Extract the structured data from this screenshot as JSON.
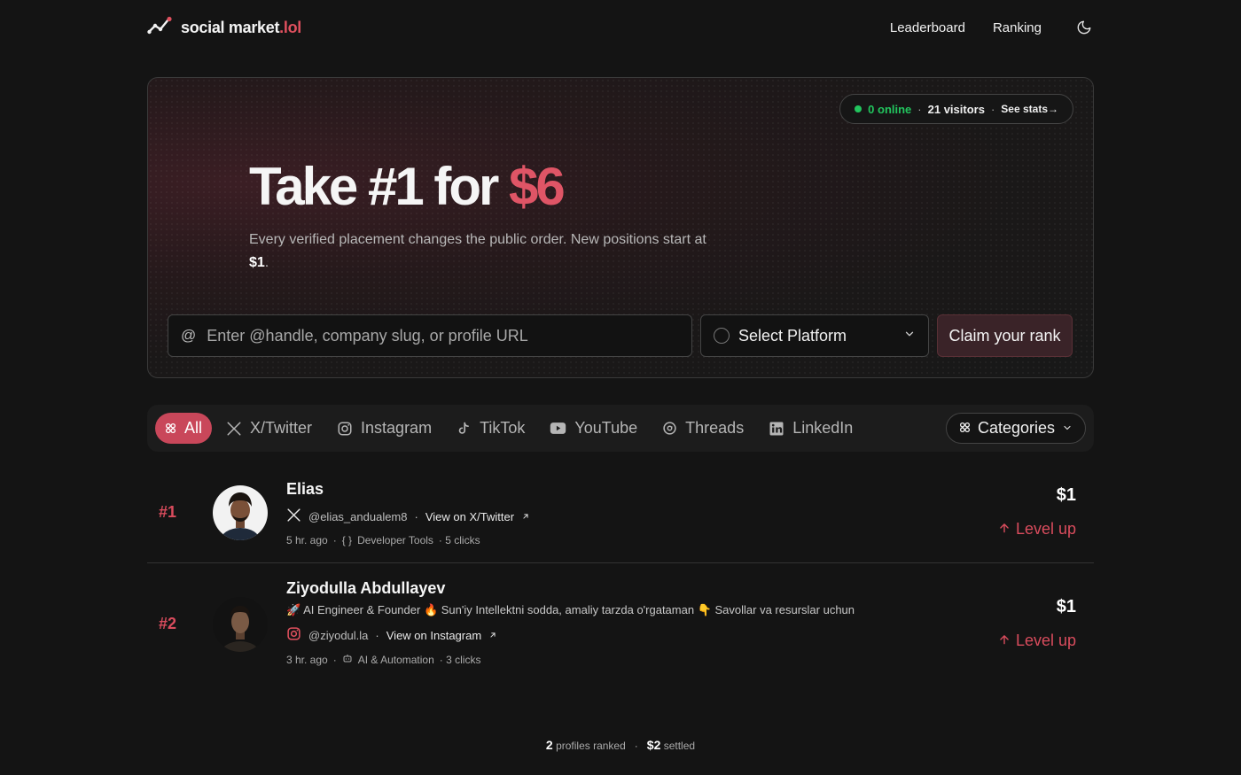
{
  "header": {
    "logo_text": "social market",
    "logo_suffix": ".lol",
    "nav": [
      "Leaderboard",
      "Ranking"
    ]
  },
  "hero": {
    "stats": {
      "online": "0 online",
      "visitors": "21 visitors",
      "see_stats": "See stats→"
    },
    "title_prefix": "Take #1 for ",
    "title_price": "$6",
    "subtitle_text": "Every verified placement changes the public order. New positions start at ",
    "subtitle_price": "$1",
    "subtitle_end": ".",
    "input_placeholder": "Enter @handle, company slug, or profile URL",
    "platform_label": "Select Platform",
    "claim_button": "Claim your rank"
  },
  "filters": {
    "tabs": [
      {
        "label": "All",
        "icon": "grid-icon",
        "active": true
      },
      {
        "label": "X/Twitter",
        "icon": "x-icon",
        "active": false
      },
      {
        "label": "Instagram",
        "icon": "instagram-icon",
        "active": false
      },
      {
        "label": "TikTok",
        "icon": "tiktok-icon",
        "active": false
      },
      {
        "label": "YouTube",
        "icon": "youtube-icon",
        "active": false
      },
      {
        "label": "Threads",
        "icon": "threads-icon",
        "active": false
      },
      {
        "label": "LinkedIn",
        "icon": "linkedin-icon",
        "active": false
      }
    ],
    "categories_label": "Categories"
  },
  "entries": [
    {
      "rank": "#1",
      "name": "Elias",
      "handle": "@elias_andualem8",
      "view_link": "View on X/Twitter",
      "time": "5 hr. ago",
      "category": "Developer Tools",
      "clicks": "· 5 clicks",
      "price": "$1",
      "level_up": "Level up"
    },
    {
      "rank": "#2",
      "name": "Ziyodulla Abdullayev",
      "bio": "🚀 AI Engineer & Founder 🔥 Sun'iy Intellektni sodda, amaliy tarzda o'rgataman 👇 Savollar va resurslar uchun",
      "handle": "@ziyodul.la",
      "view_link": "View on Instagram",
      "time": "3 hr. ago",
      "category": "AI & Automation",
      "clicks": "· 3 clicks",
      "price": "$1",
      "level_up": "Level up"
    }
  ],
  "footer": {
    "profiles_count": "2",
    "profiles_label": "profiles ranked",
    "settled_amount": "$2",
    "settled_label": "settled"
  },
  "colors": {
    "accent": "#d94c5d",
    "online": "#22c55e",
    "background": "#141414"
  }
}
